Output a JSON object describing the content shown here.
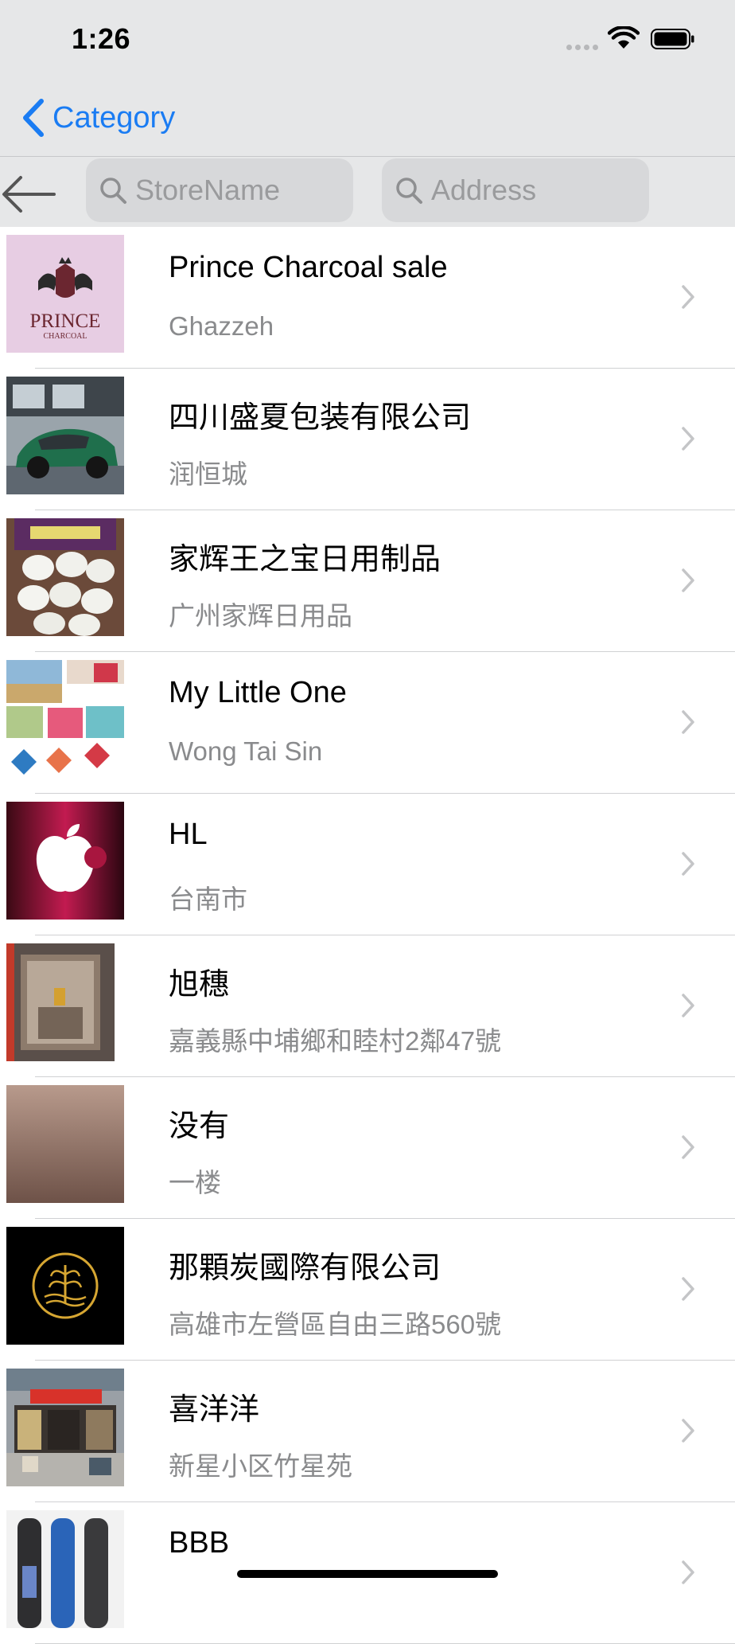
{
  "status_bar": {
    "time": "1:26"
  },
  "nav": {
    "back_label": "Category"
  },
  "search": {
    "store_placeholder": "StoreName",
    "address_placeholder": "Address"
  },
  "stores": [
    {
      "name": "Prince Charcoal sale",
      "address": "Ghazzeh"
    },
    {
      "name": "四川盛夏包装有限公司",
      "address": "润恒城"
    },
    {
      "name": "家辉王之宝日用制品",
      "address": "广州家辉日用品"
    },
    {
      "name": "My Little One",
      "address": "Wong Tai Sin"
    },
    {
      "name": "HL",
      "address": "台南市"
    },
    {
      "name": "旭穗",
      "address": "嘉義縣中埔鄉和睦村2鄰47號"
    },
    {
      "name": "没有",
      "address": "一楼"
    },
    {
      "name": "那顆炭國際有限公司",
      "address": "高雄市左營區自由三路560號"
    },
    {
      "name": "喜洋洋",
      "address": "新星小区竹星苑"
    },
    {
      "name": "BBB",
      "address": ""
    }
  ],
  "thumbnail_text": {
    "prince_logo_line1": "PRINCE",
    "prince_logo_line2": "CHARCOAL"
  },
  "colors": {
    "accent": "#1a7cf3",
    "bar_background": "#e6e7e8",
    "secondary_text": "#8a8b8d"
  }
}
